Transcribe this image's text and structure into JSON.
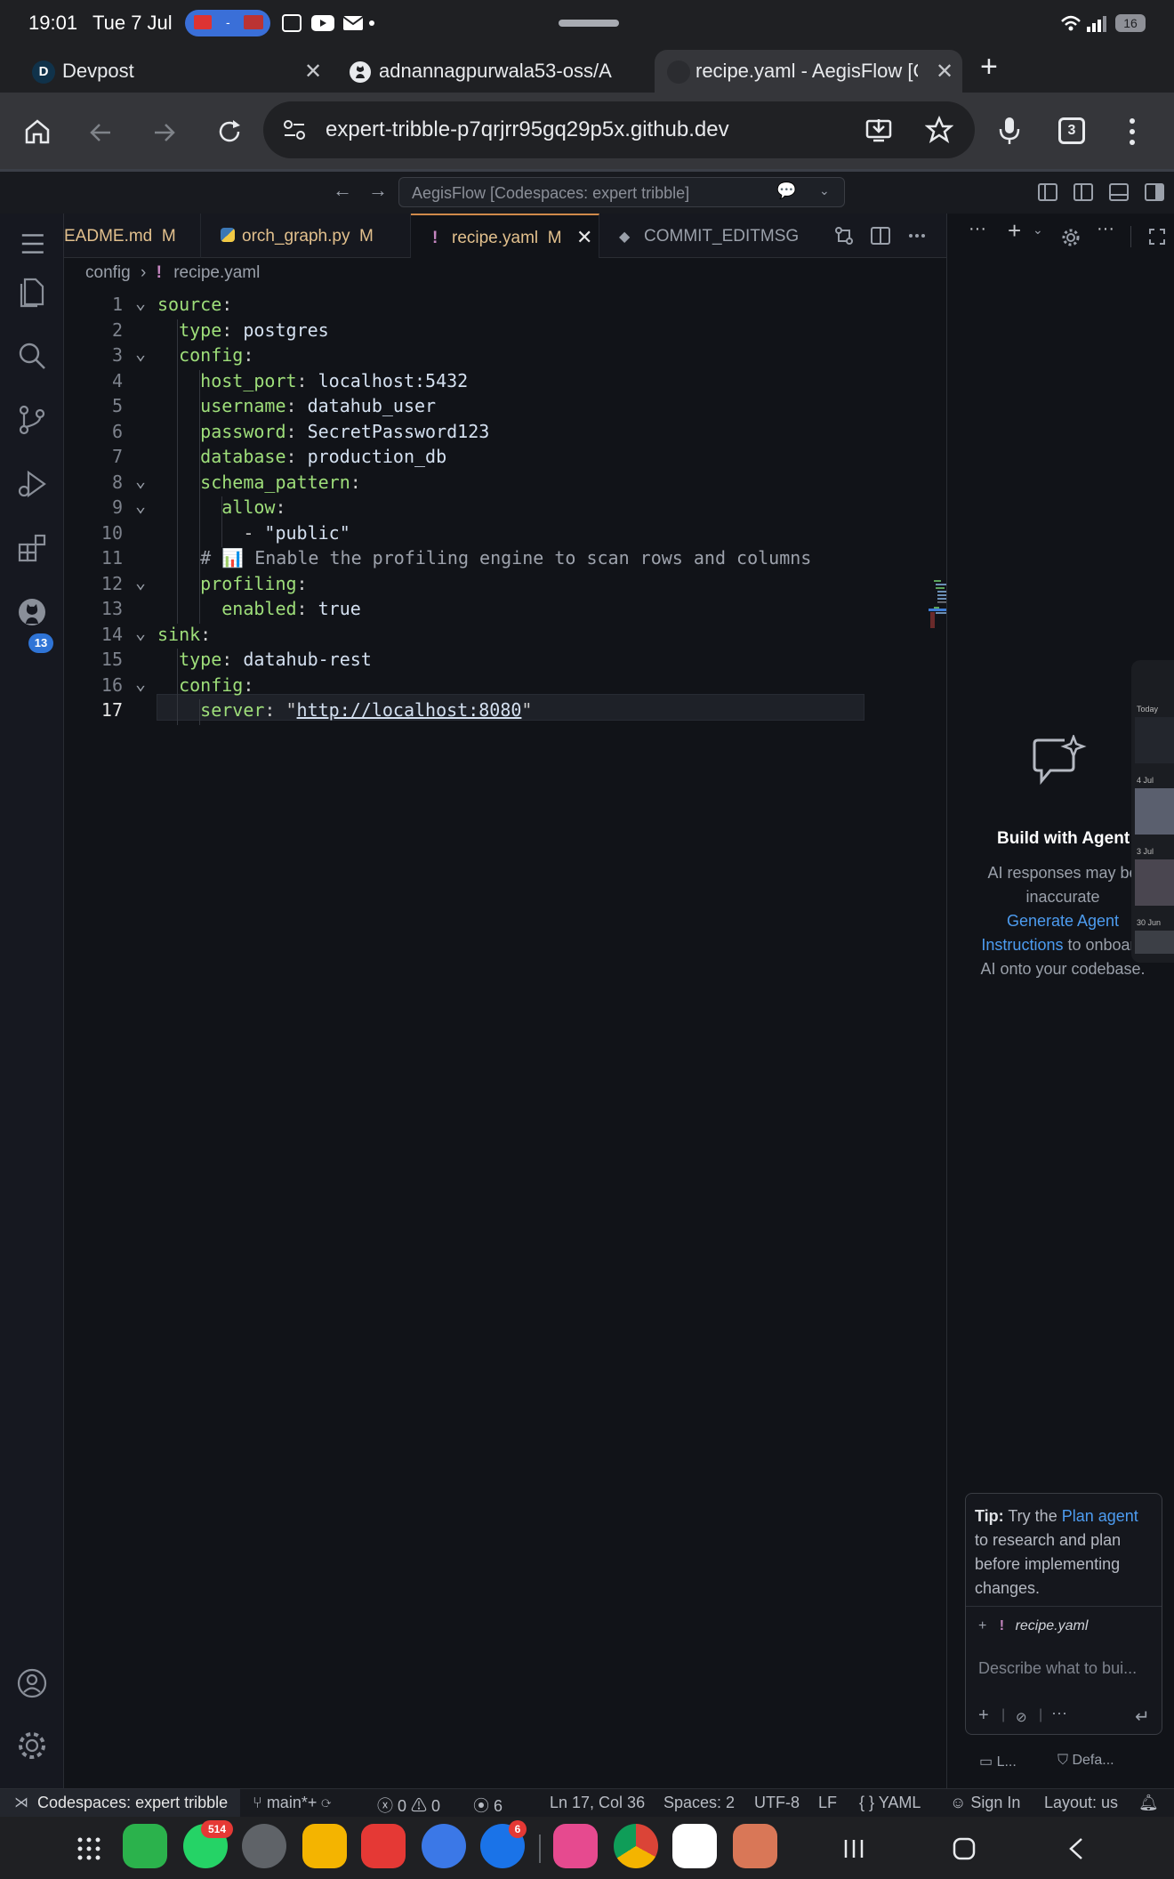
{
  "status_bar": {
    "time": "19:01",
    "date": "Tue 7 Jul",
    "battery": "16"
  },
  "browser": {
    "tabs": [
      {
        "label": "Devpost",
        "favicon": "D"
      },
      {
        "label": "adnannagpurwala53-oss/A"
      },
      {
        "label": "recipe.yaml - AegisFlow [Co"
      }
    ],
    "url": "expert-tribble-p7qrjrr95gq29p5x.github.dev",
    "tab_count": "3"
  },
  "vscode": {
    "command_center": "AegisFlow [Codespaces: expert tribble]",
    "editor_tabs": [
      {
        "label": "EADME.md",
        "badge": "M",
        "color": "#e2c08d"
      },
      {
        "label": "orch_graph.py",
        "badge": "M",
        "color": "#e2c08d"
      },
      {
        "label": "recipe.yaml",
        "badge": "M",
        "color": "#e2c08d",
        "active": true
      },
      {
        "label": "COMMIT_EDITMSG",
        "badge": "",
        "color": "#9aa0aa"
      }
    ],
    "breadcrumb": {
      "folder": "config",
      "file": "recipe.yaml"
    },
    "scm_badge": "13",
    "lines": [
      {
        "n": "1",
        "tokens": [
          {
            "t": "k",
            "v": "source"
          },
          {
            "t": "p",
            "v": ":"
          }
        ]
      },
      {
        "n": "2",
        "tokens": [
          {
            "t": "p",
            "v": "  "
          },
          {
            "t": "k",
            "v": "type"
          },
          {
            "t": "p",
            "v": ": "
          },
          {
            "t": "v",
            "v": "postgres"
          }
        ]
      },
      {
        "n": "3",
        "tokens": [
          {
            "t": "p",
            "v": "  "
          },
          {
            "t": "k",
            "v": "config"
          },
          {
            "t": "p",
            "v": ":"
          }
        ]
      },
      {
        "n": "4",
        "tokens": [
          {
            "t": "p",
            "v": "    "
          },
          {
            "t": "k",
            "v": "host_port"
          },
          {
            "t": "p",
            "v": ": "
          },
          {
            "t": "v",
            "v": "localhost:5432"
          }
        ]
      },
      {
        "n": "5",
        "tokens": [
          {
            "t": "p",
            "v": "    "
          },
          {
            "t": "k",
            "v": "username"
          },
          {
            "t": "p",
            "v": ": "
          },
          {
            "t": "v",
            "v": "datahub_user"
          }
        ]
      },
      {
        "n": "6",
        "tokens": [
          {
            "t": "p",
            "v": "    "
          },
          {
            "t": "k",
            "v": "password"
          },
          {
            "t": "p",
            "v": ": "
          },
          {
            "t": "v",
            "v": "SecretPassword123"
          }
        ]
      },
      {
        "n": "7",
        "tokens": [
          {
            "t": "p",
            "v": "    "
          },
          {
            "t": "k",
            "v": "database"
          },
          {
            "t": "p",
            "v": ": "
          },
          {
            "t": "v",
            "v": "production_db"
          }
        ]
      },
      {
        "n": "8",
        "tokens": [
          {
            "t": "p",
            "v": "    "
          },
          {
            "t": "k",
            "v": "schema_pattern"
          },
          {
            "t": "p",
            "v": ":"
          }
        ]
      },
      {
        "n": "9",
        "tokens": [
          {
            "t": "p",
            "v": "      "
          },
          {
            "t": "k",
            "v": "allow"
          },
          {
            "t": "p",
            "v": ":"
          }
        ]
      },
      {
        "n": "10",
        "tokens": [
          {
            "t": "p",
            "v": "        - "
          },
          {
            "t": "v",
            "v": "\"public\""
          }
        ]
      },
      {
        "n": "11",
        "tokens": [
          {
            "t": "p",
            "v": "    "
          },
          {
            "t": "c",
            "v": "# 📊 Enable the profiling engine to scan rows and columns"
          }
        ]
      },
      {
        "n": "12",
        "tokens": [
          {
            "t": "p",
            "v": "    "
          },
          {
            "t": "k",
            "v": "profiling"
          },
          {
            "t": "p",
            "v": ":"
          }
        ]
      },
      {
        "n": "13",
        "tokens": [
          {
            "t": "p",
            "v": "      "
          },
          {
            "t": "k",
            "v": "enabled"
          },
          {
            "t": "p",
            "v": ": "
          },
          {
            "t": "v",
            "v": "true"
          }
        ]
      },
      {
        "n": "14",
        "tokens": [
          {
            "t": "k",
            "v": "sink"
          },
          {
            "t": "p",
            "v": ":"
          }
        ]
      },
      {
        "n": "15",
        "tokens": [
          {
            "t": "p",
            "v": "  "
          },
          {
            "t": "k",
            "v": "type"
          },
          {
            "t": "p",
            "v": ": "
          },
          {
            "t": "v",
            "v": "datahub-rest"
          }
        ]
      },
      {
        "n": "16",
        "tokens": [
          {
            "t": "p",
            "v": "  "
          },
          {
            "t": "k",
            "v": "config"
          },
          {
            "t": "p",
            "v": ":"
          }
        ]
      },
      {
        "n": "17",
        "tokens": [
          {
            "t": "p",
            "v": "    "
          },
          {
            "t": "k",
            "v": "server"
          },
          {
            "t": "p",
            "v": ": \""
          },
          {
            "t": "u",
            "v": "http://localhost:8080"
          },
          {
            "t": "p",
            "v": "\""
          }
        ]
      }
    ],
    "fold_lines": [
      "1",
      "3",
      "8",
      "9",
      "12",
      "14",
      "16"
    ],
    "current_line": "17",
    "chat": {
      "title": "Build with Agent",
      "line1": "AI responses may be inaccurate",
      "link": "Generate Agent Instructions",
      "line2": "to onboard AI onto your codebase.",
      "tip_label": "Tip:",
      "tip_pre": "Try the",
      "tip_link": "Plan agent",
      "tip_post": "to research and plan before implementing changes.",
      "context_file": "recipe.yaml",
      "input_placeholder": "Describe what to bui...",
      "footer_left": "L...",
      "footer_right": "Defa..."
    },
    "status": {
      "remote": "Codespaces: expert tribble",
      "branch": "main*+",
      "errors": "0",
      "warnings": "0",
      "ports": "6",
      "position": "Ln 17, Col 36",
      "spaces": "Spaces: 2",
      "encoding": "UTF-8",
      "eol": "LF",
      "language": "YAML",
      "sign_in": "Sign In",
      "layout": "Layout: us"
    }
  },
  "thumbnails": {
    "labels": [
      "Today",
      "4 Jul",
      "3 Jul",
      "30 Jun"
    ]
  },
  "dock": {
    "whatsapp_badge": "514",
    "messages_badge": "6"
  }
}
